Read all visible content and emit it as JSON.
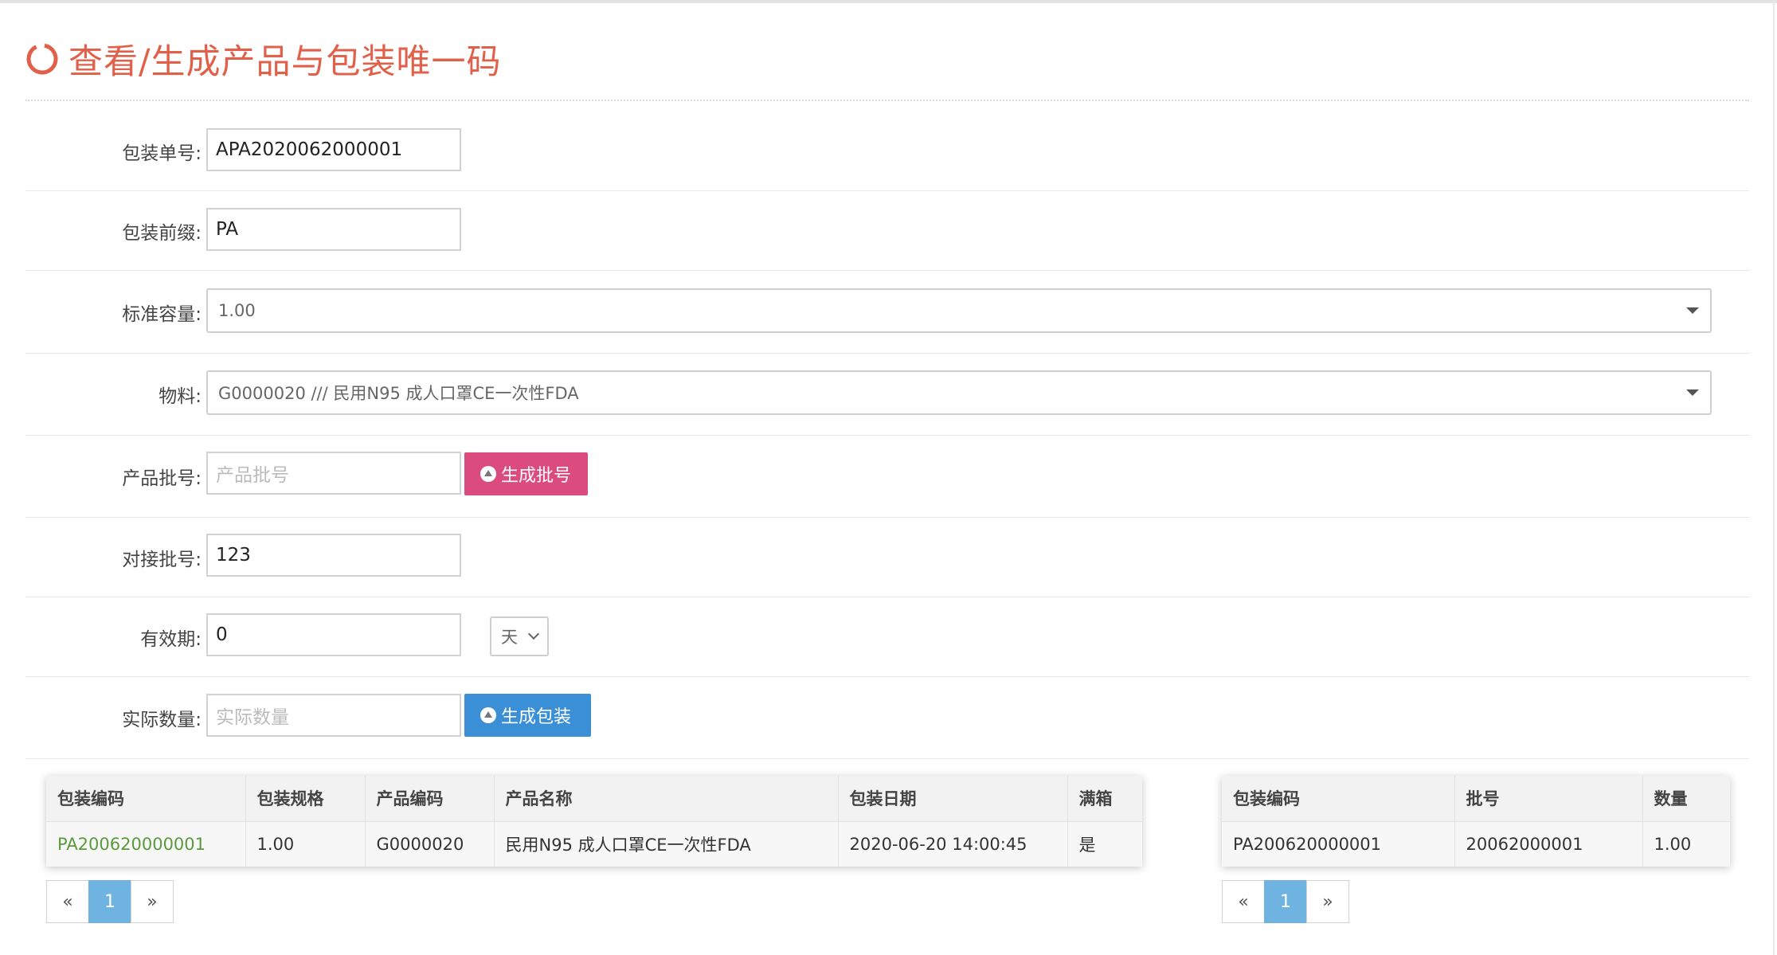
{
  "page": {
    "title": "查看/生成产品与包装唯一码"
  },
  "form": {
    "package_no": {
      "label": "包装单号:",
      "value": "APA2020062000001"
    },
    "package_prefix": {
      "label": "包装前缀:",
      "value": "PA"
    },
    "standard_capacity": {
      "label": "标准容量:",
      "value": "1.00"
    },
    "material": {
      "label": "物料:",
      "value": "G0000020 /// 民用N95 成人口罩CE一次性FDA"
    },
    "product_batch": {
      "label": "产品批号:",
      "placeholder": "产品批号",
      "button": "生成批号"
    },
    "dock_batch": {
      "label": "对接批号:",
      "value": "123"
    },
    "validity": {
      "label": "有效期:",
      "value": "0",
      "unit": "天"
    },
    "actual_qty": {
      "label": "实际数量:",
      "placeholder": "实际数量",
      "button": "生成包装"
    }
  },
  "left_table": {
    "columns": [
      "包装编码",
      "包装规格",
      "产品编码",
      "产品名称",
      "包装日期",
      "满箱"
    ],
    "rows": [
      [
        "PA200620000001",
        "1.00",
        "G0000020",
        "民用N95 成人口罩CE一次性FDA",
        "2020-06-20 14:00:45",
        "是"
      ]
    ]
  },
  "right_table": {
    "columns": [
      "包装编码",
      "批号",
      "数量"
    ],
    "rows": [
      [
        "PA200620000001",
        "20062000001",
        "1.00"
      ]
    ]
  },
  "pager": {
    "prev": "«",
    "page": "1",
    "next": "»"
  },
  "colors": {
    "title": "#e0604a",
    "pink_button": "#db4b7d",
    "blue_button": "#3b8fd6",
    "link": "#5a9a3c",
    "active_page": "#6fb3e0"
  }
}
